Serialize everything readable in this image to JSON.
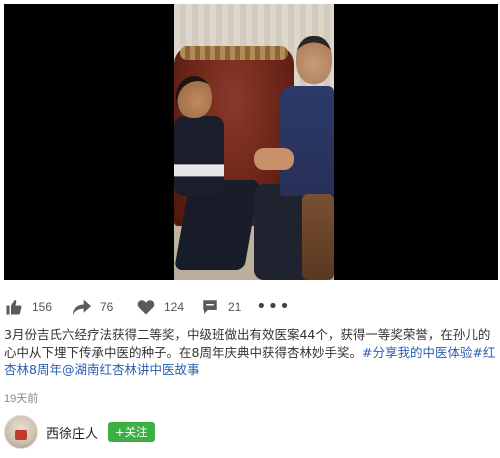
{
  "stats": {
    "likes": "156",
    "shares": "76",
    "favorites": "124",
    "comments": "21",
    "more": "•••"
  },
  "post": {
    "text": "3月份吉氏六经疗法获得二等奖，中级班做出有效医案44个，获得一等奖荣誉，在孙儿的心中从下埋下传承中医的种子。在8周年庆典中获得杏林妙手奖。",
    "tags": [
      "#分享我的中医体验",
      "#红杏林8周年",
      "@湖南红杏林讲中医故事"
    ],
    "time": "19天前"
  },
  "author": {
    "name": "西徐庄人",
    "follow_label": "+关注"
  },
  "icons": {
    "like": "thumbs-up-icon",
    "share": "share-arrow-icon",
    "favorite": "heart-icon",
    "comment": "comment-bubble-icon",
    "more": "more-dots-icon"
  },
  "colors": {
    "follow": "#3cb043",
    "tag": "#2a5db0",
    "icon": "#555555"
  }
}
